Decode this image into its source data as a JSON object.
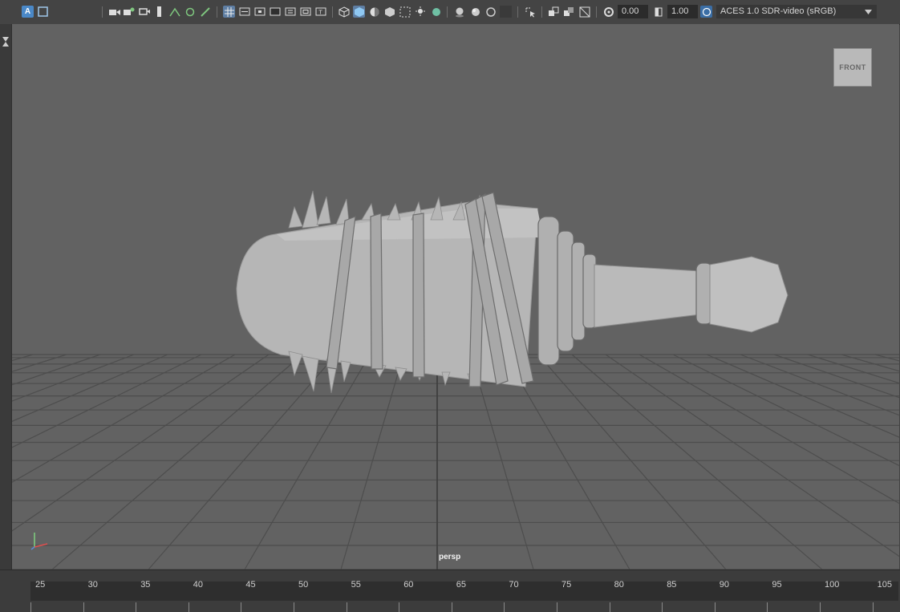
{
  "toolbar": {
    "exposure_value": "0.00",
    "gamma_value": "1.00",
    "color_management": {
      "label": "ACES 1.0 SDR-video (sRGB)",
      "icon": "color-wheel-icon"
    },
    "icons": [
      "attribute-icon",
      "select-icon",
      "camera-icon",
      "camera-attr-icon",
      "bookmark-icon",
      "image-plane-icon",
      "2d-pan-icon",
      "grease-pencil-icon",
      "grid-icon",
      "film-gate-icon",
      "resolution-gate-icon",
      "gate-mask-icon",
      "field-chart-icon",
      "safe-action-icon",
      "safe-title-icon",
      "wireframe-icon",
      "smooth-shade-icon",
      "default-lighting-icon",
      "shadows-icon",
      "xray-icon",
      "isolate-icon",
      "screen-space-ao-icon",
      "motion-blur-icon",
      "multisample-aa-icon",
      "depth-of-field-icon",
      "camera-pan-icon",
      "ortho-icon",
      "xray-joints-icon",
      "exposure-icon",
      "gamma-icon"
    ]
  },
  "viewport": {
    "camera_label": "persp",
    "viewcube_label": "FRONT",
    "colors": {
      "background": "#626262",
      "grid": "#4d4d4d",
      "model": "#b4b4b4",
      "model_shadow": "#8a8a8a"
    }
  },
  "timeline": {
    "ticks": [
      "25",
      "30",
      "35",
      "40",
      "45",
      "50",
      "55",
      "60",
      "65",
      "70",
      "75",
      "80",
      "85",
      "90",
      "95",
      "100",
      "105"
    ]
  }
}
